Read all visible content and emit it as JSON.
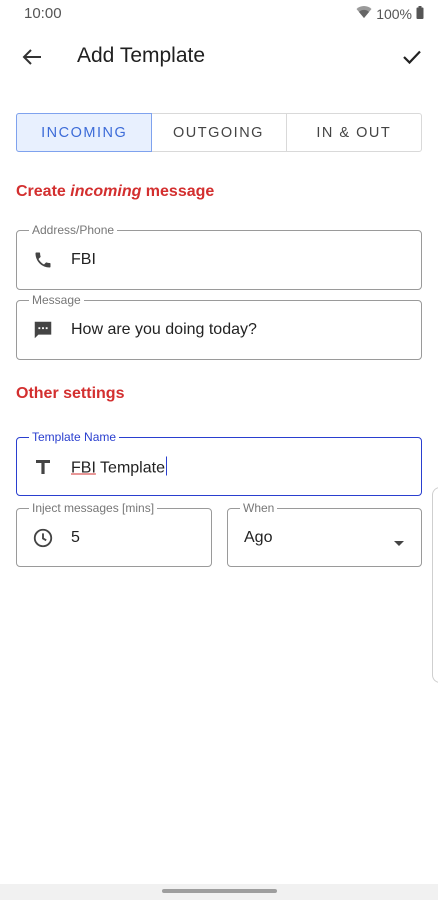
{
  "status": {
    "time": "10:00",
    "battery": "100%"
  },
  "appbar": {
    "title": "Add Template"
  },
  "tabs": [
    {
      "label": "INCOMING"
    },
    {
      "label": "OUTGOING"
    },
    {
      "label": "IN & OUT"
    }
  ],
  "section_create": {
    "prefix": "Create ",
    "emphasis": "incoming",
    "suffix": " message"
  },
  "address": {
    "label": "Address/Phone",
    "value": "FBI",
    "icon": "phone-icon"
  },
  "message": {
    "label": "Message",
    "value": "How are you doing today?",
    "icon": "message-icon"
  },
  "section_other": {
    "label": "Other settings"
  },
  "template_name": {
    "label": "Template Name",
    "value_underlined": "FBI",
    "value_rest": " Template",
    "icon": "text-t-icon"
  },
  "inject": {
    "label": "Inject messages [mins]",
    "value": "5",
    "icon": "clock-icon"
  },
  "when": {
    "label": "When",
    "value": "Ago"
  },
  "colors": {
    "accent": "#2a3fcf",
    "section": "#d32f2f",
    "tab_active_bg": "#e8f0fe"
  }
}
